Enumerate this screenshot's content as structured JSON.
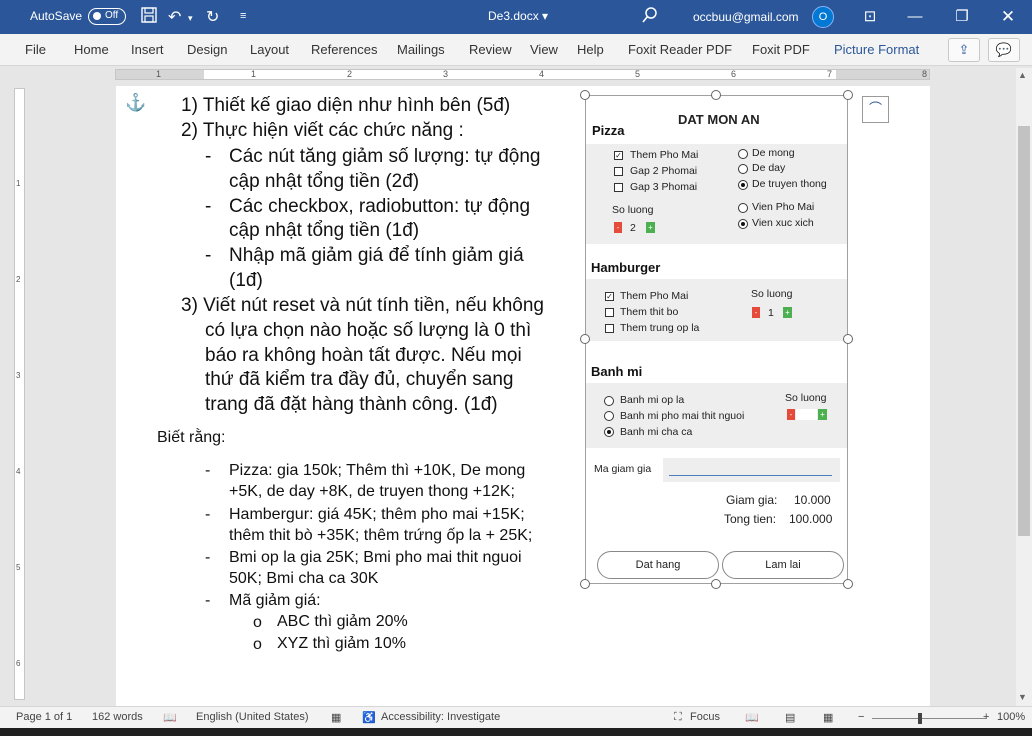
{
  "titlebar": {
    "autosave_label": "AutoSave",
    "autosave_state": "Off",
    "doc_title": "De3.docx",
    "account": "occbuu@gmail.com",
    "avatar_initial": "O",
    "icons": [
      "save-icon",
      "undo-icon",
      "redo-icon",
      "customize-icon",
      "search-icon",
      "ribbon-display-icon",
      "minimize-icon",
      "restore-icon",
      "close-icon"
    ]
  },
  "menu": {
    "tabs": [
      "File",
      "Home",
      "Insert",
      "Design",
      "Layout",
      "References",
      "Mailings",
      "Review",
      "View",
      "Help",
      "Foxit Reader PDF",
      "Foxit PDF",
      "Picture Format"
    ],
    "active_tab": "Picture Format"
  },
  "ruler": {
    "h_numbers": [
      "1",
      "1",
      "2",
      "3",
      "4",
      "5",
      "6",
      "7",
      "8"
    ],
    "v_numbers": [
      "1",
      "2",
      "3",
      "4",
      "5",
      "6"
    ]
  },
  "document": {
    "items": [
      "1) Thiết kế giao diện như hình bên (5đ)",
      "2) Thực hiện viết các chức năng :",
      "-",
      "Các nút tăng giảm số lượng: tự động",
      "cập nhật tổng tiền (2đ)",
      "-",
      "Các checkbox, radiobutton: tự động",
      "cập nhật tổng tiền (1đ)",
      "-",
      "Nhập mã giảm giá để tính giảm giá",
      "(1đ)",
      "3) Viết nút reset và nút tính tiền, nếu không",
      "có lựa chọn nào hoặc số lượng là 0 thì",
      "báo ra không hoàn tất được. Nếu mọi",
      "thứ đã kiểm tra đầy đủ, chuyển sang",
      "trang đã đặt hàng thành công. (1đ)"
    ],
    "biet_rang": "Biết rằng:",
    "notes": [
      "-",
      "Pizza: gia 150k; Thêm thì +10K, De mong",
      "+5K, de day +8K, de truyen thong +12K;",
      "-",
      "Hambergur: giá 45K; thêm pho mai +15K;",
      "thêm thit bò +35K; thêm trứng ốp la + 25K;",
      "-",
      "Bmi op la gia 25K; Bmi pho mai thit nguoi",
      "50K; Bmi cha ca 30K",
      "-",
      "Mã giảm giá:",
      "o",
      "ABC thì giảm 20%",
      "o",
      "XYZ thì giảm 10%"
    ]
  },
  "picture": {
    "title": "DAT MON AN",
    "pizza": {
      "heading": "Pizza",
      "checkboxes": [
        {
          "label": "Them Pho Mai",
          "checked": true
        },
        {
          "label": "Gap 2 Phomai",
          "checked": false
        },
        {
          "label": "Gap 3 Phomai",
          "checked": false
        }
      ],
      "crust_radios": [
        {
          "label": "De mong",
          "selected": false
        },
        {
          "label": "De day",
          "selected": false
        },
        {
          "label": "De truyen thong",
          "selected": true
        }
      ],
      "edge_radios": [
        {
          "label": "Vien Pho Mai",
          "selected": false
        },
        {
          "label": "Vien xuc xich",
          "selected": true
        }
      ],
      "qty_label": "So luong",
      "qty": "2"
    },
    "hamburger": {
      "heading": "Hamburger",
      "checkboxes": [
        {
          "label": "Them Pho Mai",
          "checked": true
        },
        {
          "label": "Them thit bo",
          "checked": false
        },
        {
          "label": "Them trung op la",
          "checked": false
        }
      ],
      "qty_label": "So luong",
      "qty": "1"
    },
    "banhmi": {
      "heading": "Banh mi",
      "radios": [
        {
          "label": "Banh mi op la",
          "selected": false
        },
        {
          "label": "Banh mi pho mai thit nguoi",
          "selected": false
        },
        {
          "label": "Banh mi cha ca",
          "selected": true
        }
      ],
      "qty_label": "So luong",
      "qty": ""
    },
    "discount_label": "Ma giam gia",
    "discount_value": "",
    "giam_gia_label": "Giam gia:",
    "giam_gia_value": "10.000",
    "tong_tien_label": "Tong tien:",
    "tong_tien_value": "100.000",
    "dat_hang_button": "Dat hang",
    "lam_lai_button": "Lam lai",
    "minus": "-",
    "plus": "+",
    "check_mark": "✓"
  },
  "status": {
    "page": "Page 1 of 1",
    "words": "162 words",
    "language": "English (United States)",
    "accessibility": "Accessibility: Investigate",
    "focus": "Focus",
    "zoom_minus": "−",
    "zoom_plus": "+",
    "zoom": "100%"
  },
  "colors": {
    "titlebar": "#2b579a",
    "minus_button": "#e64a3b",
    "plus_button": "#4caf50"
  }
}
